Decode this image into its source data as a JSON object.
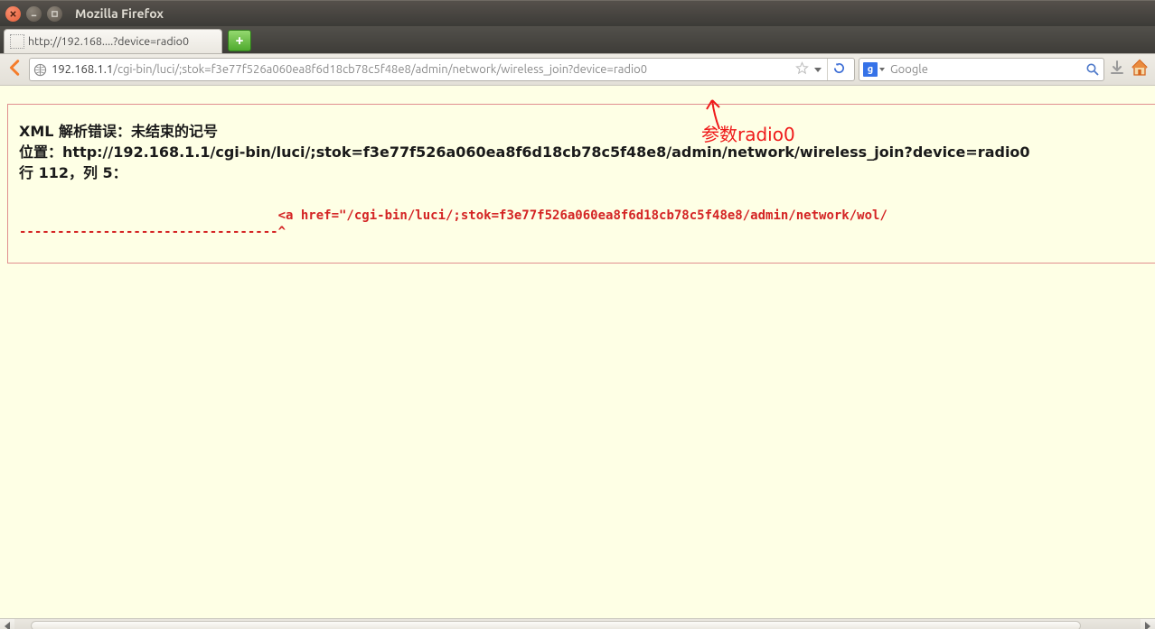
{
  "window": {
    "title": "Mozilla Firefox"
  },
  "tab": {
    "title": "http://192.168....?device=radio0"
  },
  "url": {
    "host": "192.168.1.1",
    "path": "/cgi-bin/luci/;stok=f3e77f526a060ea8f6d18cb78c5f48e8/admin/network/wireless_join?device=radio0"
  },
  "search": {
    "placeholder": "Google"
  },
  "error": {
    "line1": "XML 解析错误：未结束的记号",
    "line2": "位置：http://192.168.1.1/cgi-bin/luci/;stok=f3e77f526a060ea8f6d18cb78c5f48e8/admin/network/wireless_join?device=radio0",
    "line3": "行 112，列 5：",
    "code1": "                                  <a href=\"/cgi-bin/luci/;stok=f3e77f526a060ea8f6d18cb78c5f48e8/admin/network/wol/",
    "code2": "----------------------------------^"
  },
  "annotation": {
    "text": "参数radio0"
  }
}
